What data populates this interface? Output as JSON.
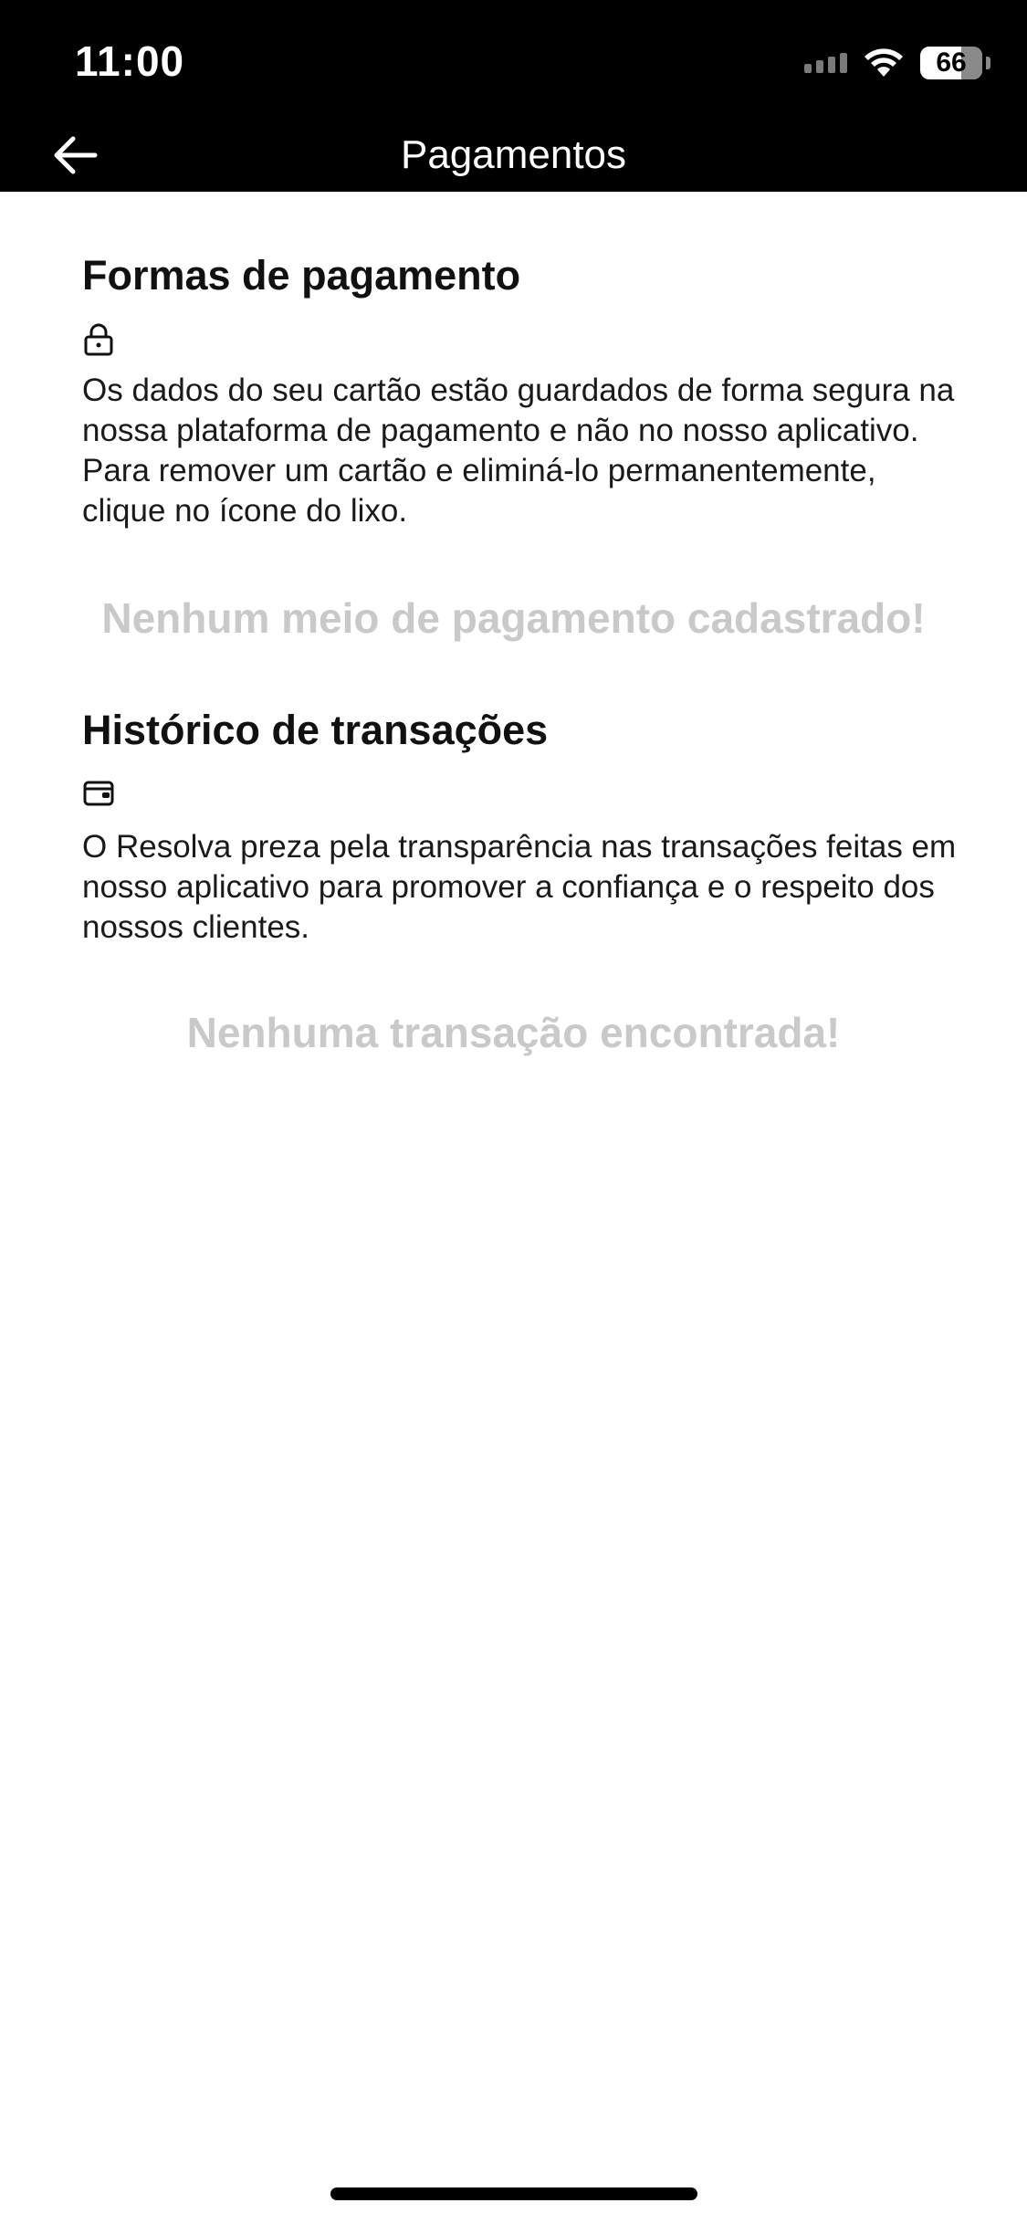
{
  "status_bar": {
    "time": "11:00",
    "battery": "66"
  },
  "nav": {
    "title": "Pagamentos",
    "back_icon": "arrow-left-icon"
  },
  "payment_methods": {
    "title": "Formas de pagamento",
    "icon": "lock-icon",
    "description": "Os dados do seu cartão estão guardados de forma segura na nossa plataforma de pagamento e não no nosso aplicativo. Para remover um cartão e eliminá-lo permanentemente, clique no ícone do lixo.",
    "empty_message": "Nenhum meio de pagamento cadastrado!"
  },
  "transaction_history": {
    "title": "Histórico de transações",
    "icon": "wallet-icon",
    "description": "O Resolva preza pela transparência nas transações feitas em nosso aplicativo para promover a confiança e o respeito dos nossos clientes.",
    "empty_message": "Nenhuma transação encontrada!"
  },
  "colors": {
    "header_bg": "#000000",
    "empty_text": "#c9c9c9",
    "body_text": "#1a1a1a"
  }
}
